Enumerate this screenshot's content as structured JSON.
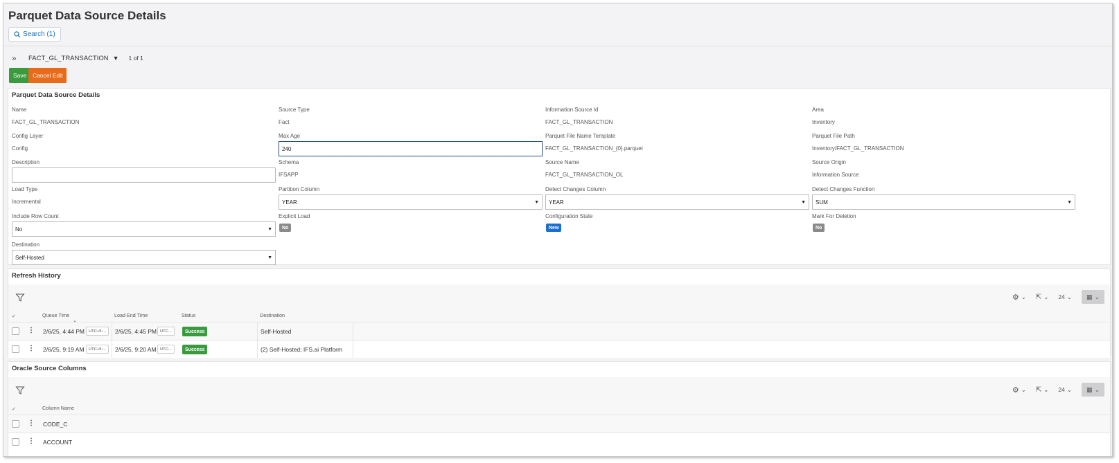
{
  "page": {
    "title": "Parquet Data Source Details"
  },
  "search": {
    "label": "Search (1)"
  },
  "record": {
    "name": "FACT_GL_TRANSACTION",
    "count": "1 of 1"
  },
  "actions": {
    "save": "Save",
    "cancel": "Cancel Edit"
  },
  "details": {
    "title": "Parquet Data Source Details",
    "name": {
      "label": "Name",
      "value": "FACT_GL_TRANSACTION"
    },
    "source_type": {
      "label": "Source Type",
      "value": "Fact"
    },
    "info_source_id": {
      "label": "Information Source Id",
      "value": "FACT_GL_TRANSACTION"
    },
    "area": {
      "label": "Area",
      "value": "Inventory"
    },
    "config_layer": {
      "label": "Config Layer",
      "value": "Config"
    },
    "max_age": {
      "label": "Max Age",
      "value": "240"
    },
    "file_name_template": {
      "label": "Parquet File Name Template",
      "value": "FACT_GL_TRANSACTION_{0}.parquet"
    },
    "file_path": {
      "label": "Parquet File Path",
      "value": "Inventory/FACT_GL_TRANSACTION"
    },
    "description": {
      "label": "Description",
      "value": ""
    },
    "schema": {
      "label": "Schema",
      "value": "IFSAPP"
    },
    "source_name": {
      "label": "Source Name",
      "value": "FACT_GL_TRANSACTION_OL"
    },
    "source_origin": {
      "label": "Source Origin",
      "value": "Information Source"
    },
    "load_type": {
      "label": "Load Type",
      "value": "Incremental"
    },
    "partition_column": {
      "label": "Partition Column",
      "value": "YEAR"
    },
    "detect_changes_column": {
      "label": "Detect Changes Column",
      "value": "YEAR"
    },
    "detect_changes_function": {
      "label": "Detect Changes Function",
      "value": "SUM"
    },
    "include_row_count": {
      "label": "Include Row Count",
      "value": "No"
    },
    "explicit_load": {
      "label": "Explicit Load",
      "value": "No"
    },
    "configuration_state": {
      "label": "Configuration State",
      "value": "New"
    },
    "mark_for_deletion": {
      "label": "Mark For Deletion",
      "value": "No"
    },
    "destination": {
      "label": "Destination",
      "value": "Self-Hosted"
    }
  },
  "refresh_history": {
    "title": "Refresh History",
    "page_size": "24",
    "columns": {
      "queue_time": "Queue Time",
      "load_end_time": "Load End Time",
      "status": "Status",
      "destination": "Destination"
    },
    "rows": [
      {
        "queue_time": "2/6/25, 4:44 PM",
        "queue_tz": "UTC+5:...",
        "load_end_time": "2/6/25, 4:45 PM",
        "load_tz": "UTC...",
        "status": "Success",
        "destination": "Self-Hosted"
      },
      {
        "queue_time": "2/6/25, 9:19 AM",
        "queue_tz": "UTC+5:...",
        "load_end_time": "2/6/25, 9:20 AM",
        "load_tz": "UTC...",
        "status": "Success",
        "destination": "(2) Self-Hosted; IFS.ai Platform"
      }
    ]
  },
  "oracle_columns": {
    "title": "Oracle Source Columns",
    "page_size": "24",
    "columns": {
      "column_name": "Column Name"
    },
    "rows": [
      {
        "column_name": "CODE_C"
      },
      {
        "column_name": "ACCOUNT"
      }
    ]
  },
  "colors": {
    "save": "#3a9b3e",
    "cancel": "#e96a18",
    "link": "#1a6fb5",
    "badge_new": "#1d6fcf",
    "badge_no": "#8a8a8a"
  }
}
